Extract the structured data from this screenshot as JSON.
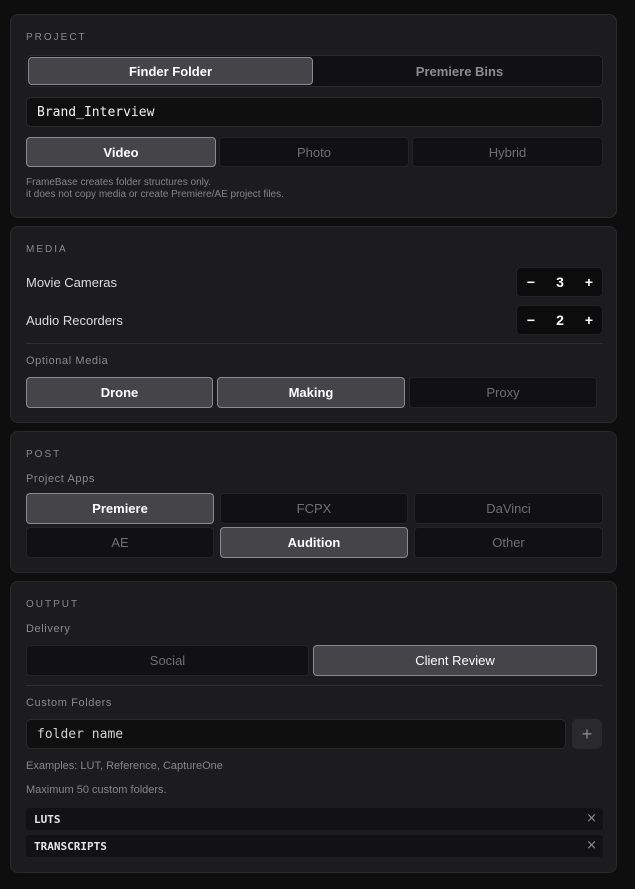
{
  "project": {
    "title": "PROJECT",
    "mode_tabs": [
      {
        "label": "Finder Folder",
        "active": true
      },
      {
        "label": "Premiere Bins",
        "active": false
      }
    ],
    "project_name": "Brand_Interview",
    "type_tabs": [
      {
        "label": "Video",
        "active": true
      },
      {
        "label": "Photo",
        "active": false
      },
      {
        "label": "Hybrid",
        "active": false
      }
    ],
    "note_line1": "FrameBase creates folder structures only.",
    "note_line2": "it does not copy media or create Premiere/AE project files."
  },
  "media": {
    "title": "MEDIA",
    "movie_cameras": {
      "label": "Movie Cameras",
      "value": "3"
    },
    "audio_recorders": {
      "label": "Audio Recorders",
      "value": "2"
    },
    "stepper_minus": "−",
    "stepper_plus": "+",
    "optional_label": "Optional Media",
    "optional_items": [
      {
        "label": "Drone",
        "active": true
      },
      {
        "label": "Making",
        "active": true
      },
      {
        "label": "Proxy",
        "active": false
      }
    ]
  },
  "post": {
    "title": "POST",
    "apps_label": "Project Apps",
    "apps": [
      {
        "label": "Premiere",
        "active": true
      },
      {
        "label": "FCPX",
        "active": false
      },
      {
        "label": "DaVinci",
        "active": false
      },
      {
        "label": "AE",
        "active": false
      },
      {
        "label": "Audition",
        "active": true
      },
      {
        "label": "Other",
        "active": false
      }
    ]
  },
  "output": {
    "title": "OUTPUT",
    "delivery_label": "Delivery",
    "delivery": [
      {
        "label": "Social",
        "active": false
      },
      {
        "label": "Client Review",
        "active": true
      }
    ],
    "custom_label": "Custom Folders",
    "folder_placeholder": "folder name",
    "add_label": "+",
    "examples": "Examples: LUT, Reference, CaptureOne",
    "max_note": "Maximum 50 custom folders.",
    "folders": [
      {
        "name": "LUTS"
      },
      {
        "name": "TRANSCRIPTS"
      }
    ],
    "remove_label": "×"
  }
}
